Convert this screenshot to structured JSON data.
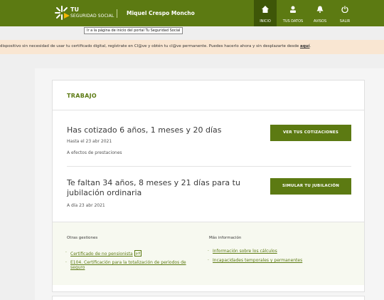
{
  "header": {
    "brand_tu": "TU",
    "brand_sub": "SEGURIDAD SOCIAL",
    "user_name": "Miquel Crespo Moncho",
    "tooltip": "Ir a la página de inicio del portal Tu Seguridad Social",
    "nav": [
      {
        "label": "INICIO",
        "icon": "home-icon"
      },
      {
        "label": "TUS DATOS",
        "icon": "user-icon"
      },
      {
        "label": "AVISOS",
        "icon": "bell-icon"
      },
      {
        "label": "SALIR",
        "icon": "power-icon"
      }
    ],
    "accent": "#5c7a12"
  },
  "banner": {
    "text": "dispositivo sin necesidad de usar tu certificado digital, regístrate en Cl@ve y obtén tu cl@ve permanente. Puedes hacerlo ahora y sin desplazarte desde ",
    "link": "aquí",
    "end": "."
  },
  "card": {
    "title": "TRABAJO",
    "cotizado": {
      "headline": "Has cotizado 6 años, 1 meses y 20 días",
      "date": "Hasta el 23 abr 2021",
      "note": "A efectos de prestaciones",
      "button": "VER TUS COTIZACIONES"
    },
    "jubilacion": {
      "headline_line1": "Te faltan 34 años, 8 meses y 21 días para tu",
      "headline_line2": "jubilación ordinaria",
      "date": "A día 23 abr 2021",
      "button": "SIMULAR TU JUBILACIÓN"
    },
    "otras": {
      "heading": "Otras gestiones",
      "links": [
        {
          "label": "Certificado de no pensionista",
          "badge": "pdf"
        },
        {
          "label_line1": "E104. Certificación para la totalización de periodos de",
          "label_line2": "seguro"
        }
      ]
    },
    "mas_info": {
      "heading": "Más información",
      "links": [
        "Información sobre los cálculos",
        "Incapacidades temporales y permanentes"
      ]
    }
  }
}
